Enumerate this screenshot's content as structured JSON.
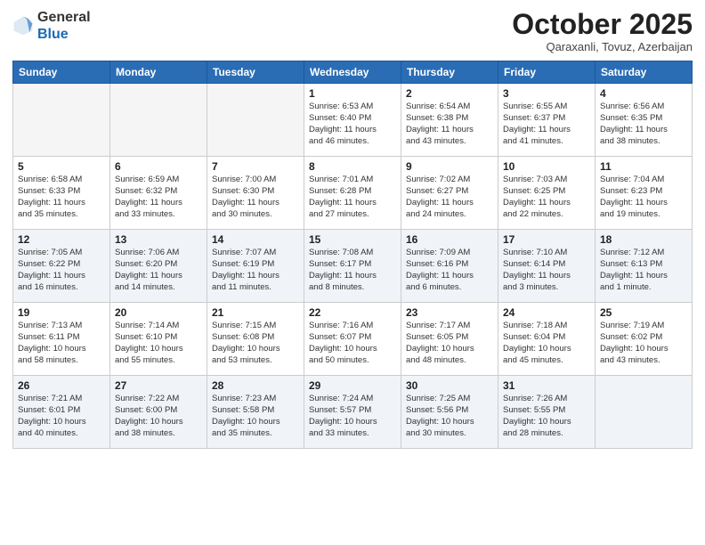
{
  "header": {
    "logo": {
      "general": "General",
      "blue": "Blue"
    },
    "title": "October 2025",
    "subtitle": "Qaraxanli, Tovuz, Azerbaijan"
  },
  "calendar": {
    "days_of_week": [
      "Sunday",
      "Monday",
      "Tuesday",
      "Wednesday",
      "Thursday",
      "Friday",
      "Saturday"
    ],
    "weeks": [
      [
        {
          "day": "",
          "info": ""
        },
        {
          "day": "",
          "info": ""
        },
        {
          "day": "",
          "info": ""
        },
        {
          "day": "1",
          "info": "Sunrise: 6:53 AM\nSunset: 6:40 PM\nDaylight: 11 hours\nand 46 minutes."
        },
        {
          "day": "2",
          "info": "Sunrise: 6:54 AM\nSunset: 6:38 PM\nDaylight: 11 hours\nand 43 minutes."
        },
        {
          "day": "3",
          "info": "Sunrise: 6:55 AM\nSunset: 6:37 PM\nDaylight: 11 hours\nand 41 minutes."
        },
        {
          "day": "4",
          "info": "Sunrise: 6:56 AM\nSunset: 6:35 PM\nDaylight: 11 hours\nand 38 minutes."
        }
      ],
      [
        {
          "day": "5",
          "info": "Sunrise: 6:58 AM\nSunset: 6:33 PM\nDaylight: 11 hours\nand 35 minutes."
        },
        {
          "day": "6",
          "info": "Sunrise: 6:59 AM\nSunset: 6:32 PM\nDaylight: 11 hours\nand 33 minutes."
        },
        {
          "day": "7",
          "info": "Sunrise: 7:00 AM\nSunset: 6:30 PM\nDaylight: 11 hours\nand 30 minutes."
        },
        {
          "day": "8",
          "info": "Sunrise: 7:01 AM\nSunset: 6:28 PM\nDaylight: 11 hours\nand 27 minutes."
        },
        {
          "day": "9",
          "info": "Sunrise: 7:02 AM\nSunset: 6:27 PM\nDaylight: 11 hours\nand 24 minutes."
        },
        {
          "day": "10",
          "info": "Sunrise: 7:03 AM\nSunset: 6:25 PM\nDaylight: 11 hours\nand 22 minutes."
        },
        {
          "day": "11",
          "info": "Sunrise: 7:04 AM\nSunset: 6:23 PM\nDaylight: 11 hours\nand 19 minutes."
        }
      ],
      [
        {
          "day": "12",
          "info": "Sunrise: 7:05 AM\nSunset: 6:22 PM\nDaylight: 11 hours\nand 16 minutes."
        },
        {
          "day": "13",
          "info": "Sunrise: 7:06 AM\nSunset: 6:20 PM\nDaylight: 11 hours\nand 14 minutes."
        },
        {
          "day": "14",
          "info": "Sunrise: 7:07 AM\nSunset: 6:19 PM\nDaylight: 11 hours\nand 11 minutes."
        },
        {
          "day": "15",
          "info": "Sunrise: 7:08 AM\nSunset: 6:17 PM\nDaylight: 11 hours\nand 8 minutes."
        },
        {
          "day": "16",
          "info": "Sunrise: 7:09 AM\nSunset: 6:16 PM\nDaylight: 11 hours\nand 6 minutes."
        },
        {
          "day": "17",
          "info": "Sunrise: 7:10 AM\nSunset: 6:14 PM\nDaylight: 11 hours\nand 3 minutes."
        },
        {
          "day": "18",
          "info": "Sunrise: 7:12 AM\nSunset: 6:13 PM\nDaylight: 11 hours\nand 1 minute."
        }
      ],
      [
        {
          "day": "19",
          "info": "Sunrise: 7:13 AM\nSunset: 6:11 PM\nDaylight: 10 hours\nand 58 minutes."
        },
        {
          "day": "20",
          "info": "Sunrise: 7:14 AM\nSunset: 6:10 PM\nDaylight: 10 hours\nand 55 minutes."
        },
        {
          "day": "21",
          "info": "Sunrise: 7:15 AM\nSunset: 6:08 PM\nDaylight: 10 hours\nand 53 minutes."
        },
        {
          "day": "22",
          "info": "Sunrise: 7:16 AM\nSunset: 6:07 PM\nDaylight: 10 hours\nand 50 minutes."
        },
        {
          "day": "23",
          "info": "Sunrise: 7:17 AM\nSunset: 6:05 PM\nDaylight: 10 hours\nand 48 minutes."
        },
        {
          "day": "24",
          "info": "Sunrise: 7:18 AM\nSunset: 6:04 PM\nDaylight: 10 hours\nand 45 minutes."
        },
        {
          "day": "25",
          "info": "Sunrise: 7:19 AM\nSunset: 6:02 PM\nDaylight: 10 hours\nand 43 minutes."
        }
      ],
      [
        {
          "day": "26",
          "info": "Sunrise: 7:21 AM\nSunset: 6:01 PM\nDaylight: 10 hours\nand 40 minutes."
        },
        {
          "day": "27",
          "info": "Sunrise: 7:22 AM\nSunset: 6:00 PM\nDaylight: 10 hours\nand 38 minutes."
        },
        {
          "day": "28",
          "info": "Sunrise: 7:23 AM\nSunset: 5:58 PM\nDaylight: 10 hours\nand 35 minutes."
        },
        {
          "day": "29",
          "info": "Sunrise: 7:24 AM\nSunset: 5:57 PM\nDaylight: 10 hours\nand 33 minutes."
        },
        {
          "day": "30",
          "info": "Sunrise: 7:25 AM\nSunset: 5:56 PM\nDaylight: 10 hours\nand 30 minutes."
        },
        {
          "day": "31",
          "info": "Sunrise: 7:26 AM\nSunset: 5:55 PM\nDaylight: 10 hours\nand 28 minutes."
        },
        {
          "day": "",
          "info": ""
        }
      ]
    ]
  }
}
